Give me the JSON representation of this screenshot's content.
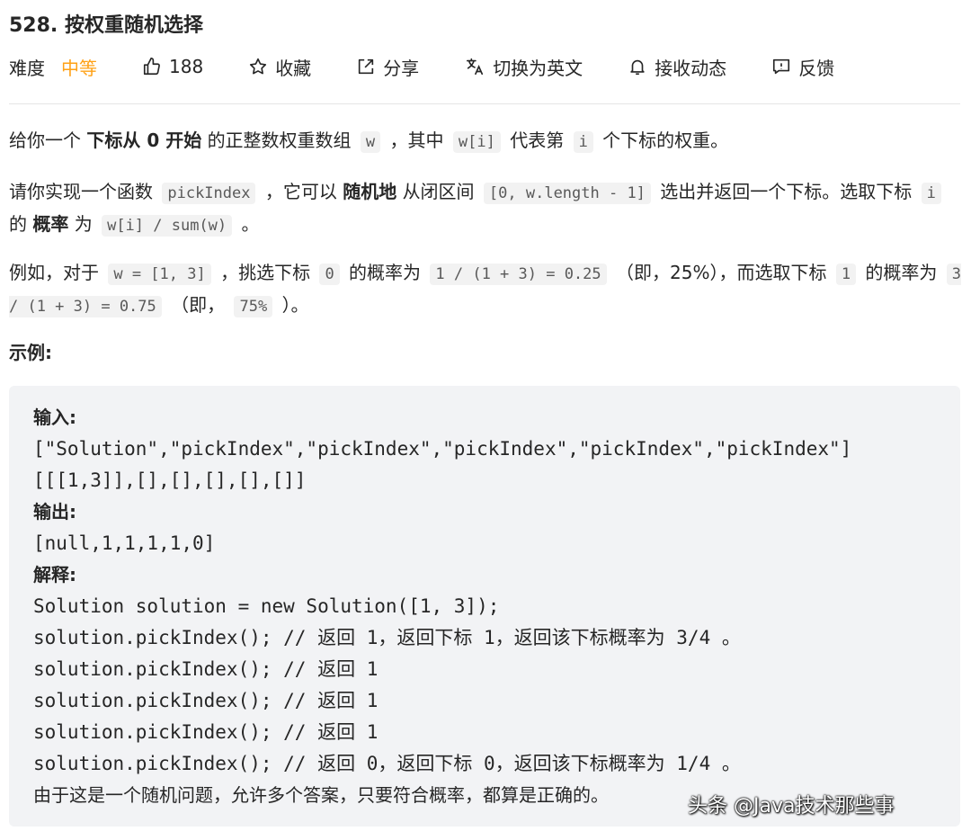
{
  "problem": {
    "title": "528. 按权重随机选择"
  },
  "meta": {
    "difficulty_label": "难度",
    "difficulty_value": "中等",
    "likes": "188",
    "favorite": "收藏",
    "share": "分享",
    "switch_lang": "切换为英文",
    "subscribe": "接收动态",
    "feedback": "反馈"
  },
  "desc": {
    "p1": {
      "a": "给你一个",
      "b": "下标从 0 开始",
      "c": "的正整数权重数组",
      "code1": "w",
      "d": "，其中",
      "code2": "w[i]",
      "e": "代表第",
      "code3": "i",
      "f": "个下标的权重。"
    },
    "p2": {
      "a": "请你实现一个函数",
      "code1": "pickIndex",
      "b": "，它可以",
      "c": "随机地",
      "d": "从闭区间",
      "code2": "[0, w.length - 1]",
      "e": "选出并返回一个下标。选取下标",
      "code3": "i",
      "f": "的",
      "g": "概率",
      "h": "为",
      "code4": "w[i] / sum(w)",
      "i": "。"
    },
    "p3": {
      "a": "例如，对于",
      "code1": "w = [1, 3]",
      "b": "，挑选下标",
      "code2": "0",
      "c": "的概率为",
      "code3": "1 / (1 + 3) = 0.25",
      "d": "（即，25%），而选取下标",
      "code4": "1",
      "e": "的概率为",
      "code5": "3 / (1 + 3) = 0.75",
      "f": "（即，",
      "code6": "75%",
      "g": "）。"
    }
  },
  "example": {
    "title": "示例:",
    "lines": [
      "输入:",
      "[\"Solution\",\"pickIndex\",\"pickIndex\",\"pickIndex\",\"pickIndex\",\"pickIndex\"]",
      "[[[1,3]],[],[],[],[],[]]",
      "输出:",
      "[null,1,1,1,1,0]",
      "解释:",
      "Solution solution = new Solution([1, 3]);",
      "solution.pickIndex(); // 返回 1，返回下标 1，返回该下标概率为 3/4 。",
      "solution.pickIndex(); // 返回 1",
      "solution.pickIndex(); // 返回 1",
      "solution.pickIndex(); // 返回 1",
      "solution.pickIndex(); // 返回 0，返回下标 0，返回该下标概率为 1/4 。",
      "由于这是一个随机问题，允许多个答案，只要符合概率，都算是正确的。"
    ]
  },
  "watermark": "头条 @Java技术那些事",
  "colors": {
    "accent_medium": "#ffa116",
    "code_bg": "#f2f2f2",
    "pre_bg": "#f2f3f5"
  }
}
